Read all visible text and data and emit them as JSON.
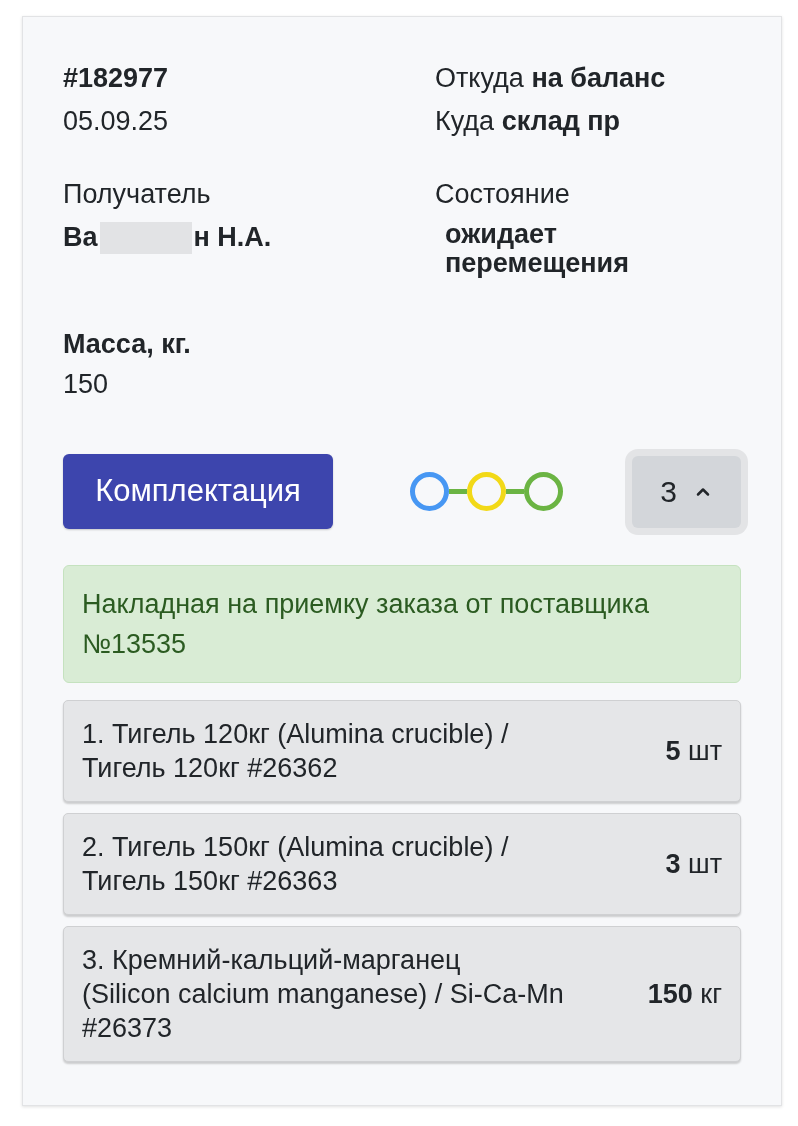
{
  "order": {
    "number": "#182977",
    "date": "05.09.25"
  },
  "route": [
    {
      "label": "Откуда",
      "value": "на баланс"
    },
    {
      "label": "Куда",
      "value": "склад пр"
    }
  ],
  "recipient": {
    "label": "Получатель",
    "value_start": "Ва",
    "value_end": "н Н.А.",
    "redacted": true
  },
  "status": {
    "label": "Состояние",
    "value": "ожидает перемещения"
  },
  "mass": {
    "label": "Масса, кг.",
    "value": "150"
  },
  "actions": {
    "button": "Комплектация",
    "steps": [
      {
        "color": "#4797f3"
      },
      {
        "color": "#f2d917"
      },
      {
        "color": "#6bb443"
      }
    ],
    "toggle": {
      "count": "3",
      "expanded": true
    }
  },
  "alert": {
    "text": "Накладная на приемку заказа от поставщика №13535"
  },
  "items": [
    {
      "name_lines": [
        "1. Тигель 120кг (Alumina crucible) /",
        "Тигель 120кг #26362"
      ],
      "quantity": "5",
      "unit": "шт"
    },
    {
      "name_lines": [
        "2. Тигель 150кг (Alumina crucible) /",
        "Тигель 150кг #26363"
      ],
      "quantity": "3",
      "unit": "шт"
    },
    {
      "name_lines": [
        "3. Кремний-кальций-марганец",
        "(Silicon calcium manganese) / Si-Ca-Mn",
        "#26373"
      ],
      "quantity": "150",
      "unit": "кг"
    }
  ]
}
